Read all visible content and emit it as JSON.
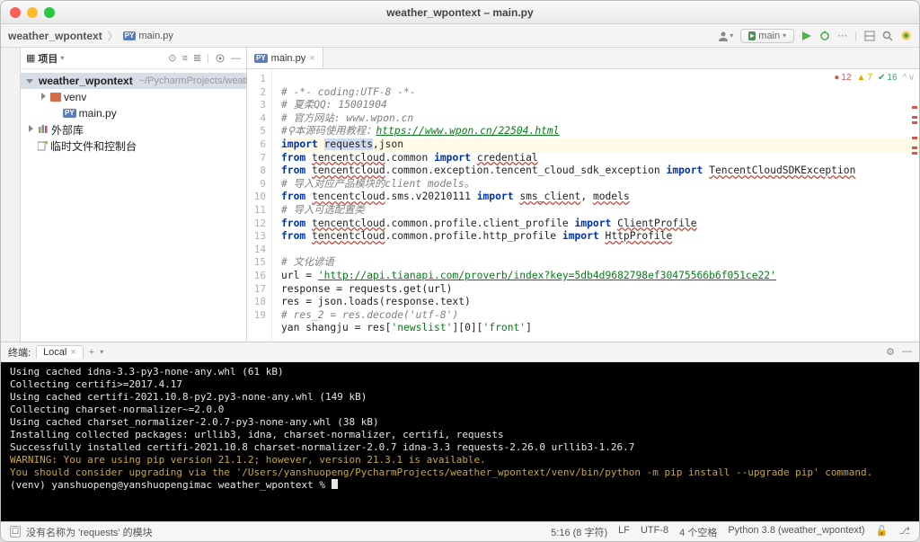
{
  "window": {
    "title": "weather_wpontext – main.py"
  },
  "breadcrumbs": {
    "project": "weather_wpontext",
    "file": "main.py"
  },
  "toolbar": {
    "interpreter_label": "main"
  },
  "sidebar": {
    "header": "项目",
    "tree": {
      "root": {
        "name": "weather_wpontext",
        "hint": "~/PycharmProjects/weather_w"
      },
      "venv": "venv",
      "main_py": "main.py",
      "libs": "外部库",
      "scratch": "临时文件和控制台"
    }
  },
  "tabs": {
    "active": "main.py"
  },
  "badges": {
    "err": "12",
    "warn": "7",
    "ok": "16"
  },
  "code": {
    "l1": "# -*- coding:UTF-8 -*-",
    "l2": "# 夏柔QQ: 15001904",
    "l3": "# 官方网站: www.wpon.cn",
    "l4_pre": "#",
    "l4_txt": "本源码使用教程：",
    "l4_link": "https://www.wpon.cn/22504.html",
    "l5_kw": "import",
    "l5_req": "requests",
    "l5_rest": ",json",
    "l6_kw1": "from",
    "l6_m": "tencentcloud",
    "l6_p": ".common",
    "l6_kw2": "import",
    "l6_t": "credential",
    "l7_kw1": "from",
    "l7_m": "tencentcloud",
    "l7_p": ".common.exception.tencent_cloud_sdk_exception",
    "l7_kw2": "import",
    "l7_t": "TencentCloudSDKException",
    "l8": "# 导入对应产品模块的client models。",
    "l9_kw1": "from",
    "l9_m": "tencentcloud",
    "l9_p": ".sms.v20210111",
    "l9_kw2": "import",
    "l9_t1": "sms_client",
    "l9_sep": ", ",
    "l9_t2": "models",
    "l10": "# 导入可选配置类",
    "l11_kw1": "from",
    "l11_m": "tencentcloud",
    "l11_p": ".common.profile.client_profile",
    "l11_kw2": "import",
    "l11_t": "ClientProfile",
    "l12_kw1": "from",
    "l12_m": "tencentcloud",
    "l12_p": ".common.profile.http_profile",
    "l12_kw2": "import",
    "l12_t": "HttpProfile",
    "l14": "# 文化谚语",
    "l15_pre": "url = ",
    "l15_s": "'http://api.tianapi.com/proverb/index?key=5db4d9682798ef30475566b6f051ce22'",
    "l16": "response = requests.get(url)",
    "l17": "res = json.loads(response.text)",
    "l18": "# res_2 = res.decode('utf-8')",
    "l19_pre": "yan shangju = res[",
    "l19_s1": "'newslist'",
    "l19_mid": "][",
    "l19_n": "0",
    "l19_mid2": "][",
    "l19_s2": "'front'",
    "l19_end": "]"
  },
  "terminal": {
    "label": "终端:",
    "tab": "Local",
    "l1": "  Using cached idna-3.3-py3-none-any.whl (61 kB)",
    "l2": "Collecting certifi>=2017.4.17",
    "l3": "  Using cached certifi-2021.10.8-py2.py3-none-any.whl (149 kB)",
    "l4": "Collecting charset-normalizer~=2.0.0",
    "l5": "  Using cached charset_normalizer-2.0.7-py3-none-any.whl (38 kB)",
    "l6": "Installing collected packages: urllib3, idna, charset-normalizer, certifi, requests",
    "l7": "Successfully installed certifi-2021.10.8 charset-normalizer-2.0.7 idna-3.3 requests-2.26.0 urllib3-1.26.7",
    "l8": "WARNING: You are using pip version 21.1.2; however, version 21.3.1 is available.",
    "l9": "You should consider upgrading via the '/Users/yanshuopeng/PycharmProjects/weather_wpontext/venv/bin/python -m pip install --upgrade pip' command.",
    "prompt": "(venv) yanshuopeng@yanshuopengimac weather_wpontext % "
  },
  "status": {
    "msg": "没有名称为 'requests' 的模块",
    "pos": "5:16 (8 字符)",
    "lf": "LF",
    "enc": "UTF-8",
    "indent": "4 个空格",
    "env": "Python 3.8 (weather_wpontext)"
  }
}
